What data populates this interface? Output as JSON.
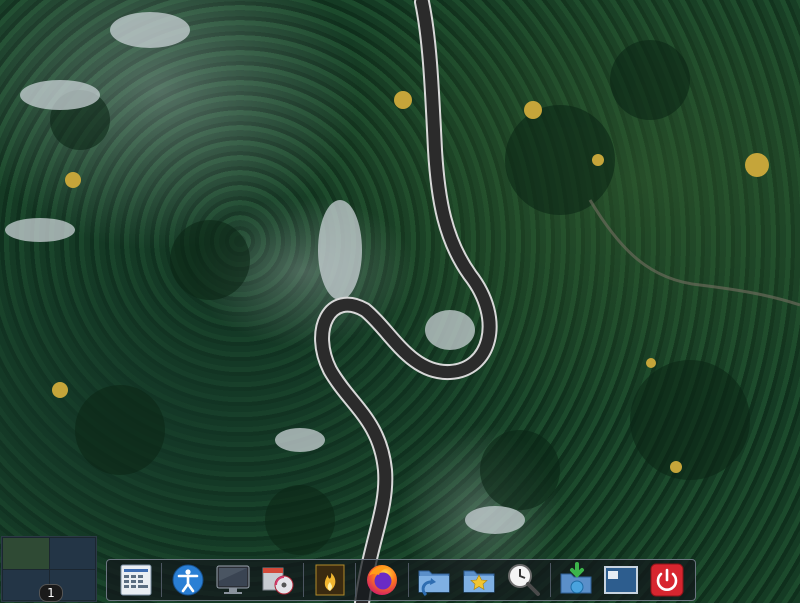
{
  "desktop": {
    "wallpaper": "aerial-forest-road",
    "pager": {
      "active_workspace": "1"
    }
  },
  "dock": {
    "items": [
      {
        "name": "app-icon",
        "icon": "calculator-table-icon"
      },
      {
        "name": "accessibility",
        "icon": "accessibility-icon"
      },
      {
        "name": "display",
        "icon": "monitor-icon"
      },
      {
        "name": "software-installer",
        "icon": "package-cd-icon"
      },
      {
        "name": "image-viewer",
        "icon": "fire-image-icon"
      },
      {
        "name": "firefox",
        "icon": "firefox-icon"
      },
      {
        "name": "file-manager",
        "icon": "folder-refresh-icon"
      },
      {
        "name": "bookmarks",
        "icon": "folder-star-icon"
      },
      {
        "name": "search-files",
        "icon": "clock-search-icon"
      },
      {
        "name": "downloads",
        "icon": "download-globe-icon"
      },
      {
        "name": "desktop-switch",
        "icon": "window-layout-icon"
      },
      {
        "name": "power",
        "icon": "power-icon"
      }
    ]
  }
}
